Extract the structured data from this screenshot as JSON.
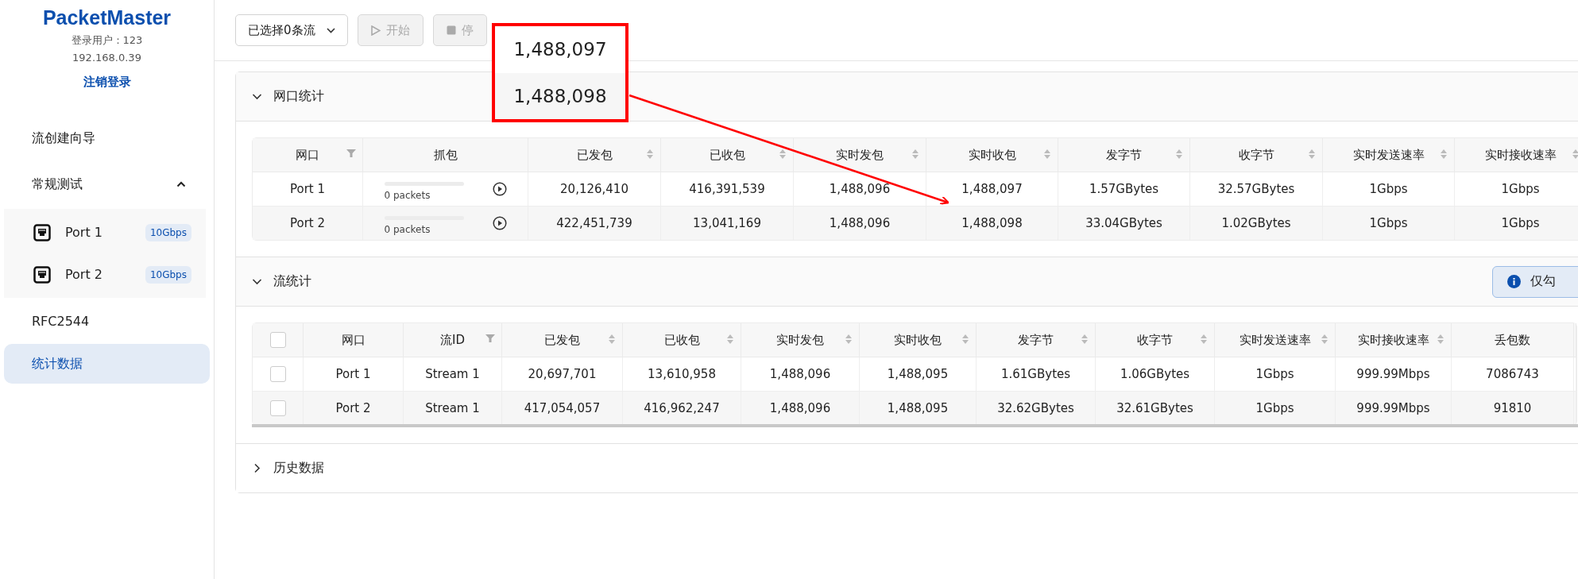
{
  "sidebar": {
    "logo": "PacketMaster",
    "user": "登录用户：123",
    "ip": "192.168.0.39",
    "logout": "注销登录",
    "items": [
      {
        "kind": "link",
        "label": "流创建向导",
        "selected": false
      },
      {
        "kind": "group",
        "label": "常规测试",
        "selected": false,
        "expanded": true,
        "children": [
          {
            "label": "Port 1",
            "speed": "10Gbps",
            "selected": false
          },
          {
            "label": "Port 2",
            "speed": "10Gbps",
            "selected": false
          }
        ]
      },
      {
        "kind": "link",
        "label": "RFC2544",
        "selected": false
      },
      {
        "kind": "link",
        "label": "统计数据",
        "selected": true
      }
    ]
  },
  "toolbar": {
    "stream_select": "已选择0条流",
    "buttons": [
      {
        "kind": "play",
        "label": "开始",
        "disabled": true
      },
      {
        "kind": "stop",
        "label": "停",
        "disabled": true
      }
    ]
  },
  "sections": [
    {
      "kind": "port_table",
      "title": "网口统计",
      "expanded": true,
      "columns": [
        {
          "label": "网口",
          "kind": "filter"
        },
        {
          "label": "抓包",
          "kind": "plain"
        },
        {
          "label": "已发包",
          "kind": "sort"
        },
        {
          "label": "已收包",
          "kind": "sort"
        },
        {
          "label": "实时发包",
          "kind": "sort"
        },
        {
          "label": "实时收包",
          "kind": "sort"
        },
        {
          "label": "发字节",
          "kind": "sort"
        },
        {
          "label": "收字节",
          "kind": "sort"
        },
        {
          "label": "实时发送速率",
          "kind": "sort"
        },
        {
          "label": "实时接收速率",
          "kind": "sort"
        }
      ],
      "rows": [
        {
          "port": "Port 1",
          "capture": {
            "level": 0,
            "count": "0 packets"
          },
          "values": [
            "20,126,410",
            "416,391,539",
            "1,488,096",
            "1,488,097",
            "1.57GBytes",
            "32.57GBytes",
            "1Gbps",
            "1Gbps"
          ]
        },
        {
          "port": "Port 2",
          "capture": {
            "level": 0,
            "count": "0 packets"
          },
          "values": [
            "422,451,739",
            "13,041,169",
            "1,488,096",
            "1,488,098",
            "33.04GBytes",
            "1.02GBytes",
            "1Gbps",
            "1Gbps"
          ]
        }
      ]
    },
    {
      "kind": "stream_table",
      "title": "流统计",
      "expanded": true,
      "notice": "仅勾",
      "select_all_checked": false,
      "columns": [
        {
          "label": "网口",
          "kind": "plain"
        },
        {
          "label": "流ID",
          "kind": "filter"
        },
        {
          "label": "已发包",
          "kind": "sort"
        },
        {
          "label": "已收包",
          "kind": "sort"
        },
        {
          "label": "实时发包",
          "kind": "sort"
        },
        {
          "label": "实时收包",
          "kind": "sort"
        },
        {
          "label": "发字节",
          "kind": "sort"
        },
        {
          "label": "收字节",
          "kind": "sort"
        },
        {
          "label": "实时发送速率",
          "kind": "sort"
        },
        {
          "label": "实时接收速率",
          "kind": "sort"
        },
        {
          "label": "丢包数",
          "kind": "plain"
        }
      ],
      "rows": [
        {
          "checked": false,
          "values": [
            "Port 1",
            "Stream 1",
            "20,697,701",
            "13,610,958",
            "1,488,096",
            "1,488,095",
            "1.61GBytes",
            "1.06GBytes",
            "1Gbps",
            "999.99Mbps",
            "7086743"
          ]
        },
        {
          "checked": false,
          "values": [
            "Port 2",
            "Stream 1",
            "417,054,057",
            "416,962,247",
            "1,488,096",
            "1,488,095",
            "32.62GBytes",
            "32.61GBytes",
            "1Gbps",
            "999.99Mbps",
            "91810"
          ]
        }
      ]
    },
    {
      "kind": "collapsed",
      "title": "历史数据",
      "expanded": false
    }
  ],
  "callout": {
    "values": [
      "1,488,097",
      "1,488,098"
    ]
  }
}
